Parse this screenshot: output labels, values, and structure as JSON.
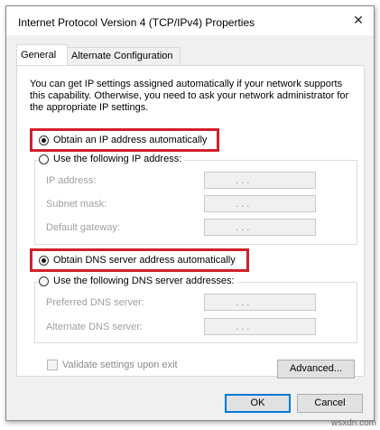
{
  "window": {
    "title": "Internet Protocol Version 4 (TCP/IPv4) Properties",
    "close_glyph": "✕"
  },
  "tabs": [
    {
      "label": "General",
      "active": true
    },
    {
      "label": "Alternate Configuration",
      "active": false
    }
  ],
  "description": "You can get IP settings assigned automatically if your network supports this capability. Otherwise, you need to ask your network administrator for the appropriate IP settings.",
  "ip_section": {
    "auto_label": "Obtain an IP address automatically",
    "manual_label": "Use the following IP address:",
    "auto_selected": true,
    "fields": [
      {
        "label": "IP address:",
        "value": ".   .   ."
      },
      {
        "label": "Subnet mask:",
        "value": ".   .   ."
      },
      {
        "label": "Default gateway:",
        "value": ".   .   ."
      }
    ]
  },
  "dns_section": {
    "auto_label": "Obtain DNS server address automatically",
    "manual_label": "Use the following DNS server addresses:",
    "auto_selected": true,
    "fields": [
      {
        "label": "Preferred DNS server:",
        "value": ".   .   ."
      },
      {
        "label": "Alternate DNS server:",
        "value": ".   .   ."
      }
    ]
  },
  "validate_label": "Validate settings upon exit",
  "buttons": {
    "advanced": "Advanced...",
    "ok": "OK",
    "cancel": "Cancel"
  },
  "watermark": "wsxdn.com",
  "colors": {
    "highlight": "#d0202a",
    "accent": "#0078d7"
  }
}
